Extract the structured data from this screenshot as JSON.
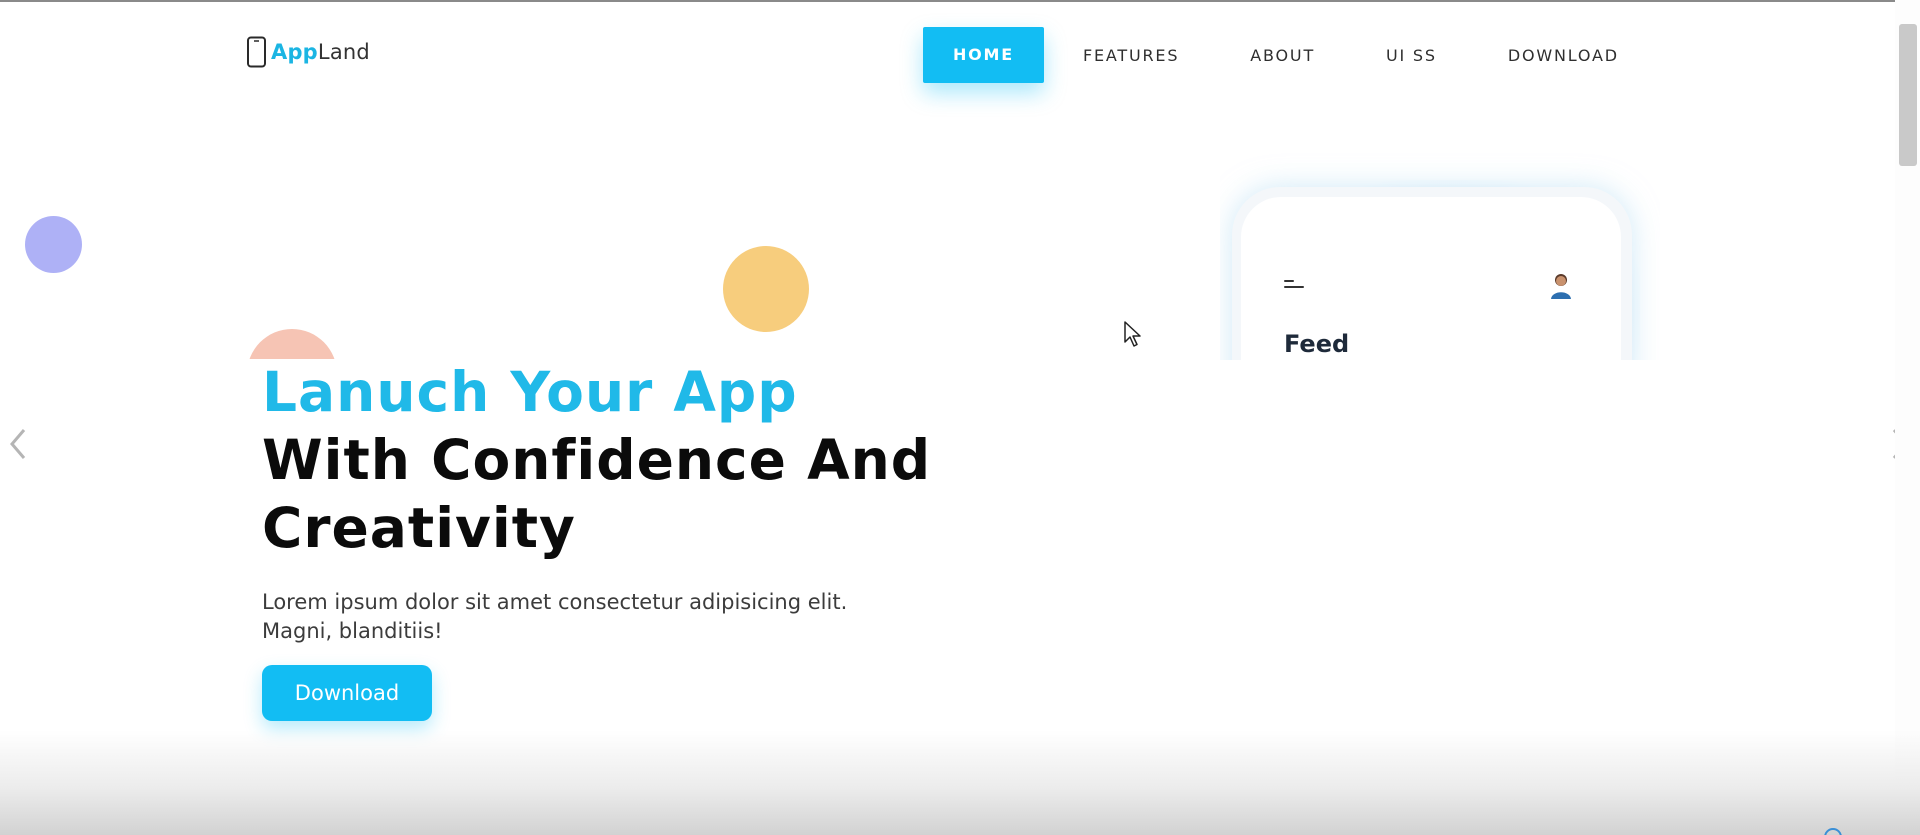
{
  "brand": {
    "name_part1": "App",
    "name_part2": "Land",
    "icon": "phone-outline-icon",
    "primary_color": "#12bdf3",
    "text_color": "#333333"
  },
  "nav": {
    "items": [
      {
        "label": "HOME",
        "active": true
      },
      {
        "label": "FEATURES",
        "active": false
      },
      {
        "label": "ABOUT",
        "active": false
      },
      {
        "label": "UI SS",
        "active": false
      },
      {
        "label": "DOWNLOAD",
        "active": false
      }
    ]
  },
  "hero": {
    "title_line1": "Lanuch Your App",
    "title_line2": "With Confidence And",
    "title_line3": "Creativity",
    "description_line1": "Lorem ipsum dolor sit amet consectetur adipisicing elit.",
    "description_line2": "Magni, blanditiis!",
    "button_label": "Download",
    "title_accent_color": "#20b9e8",
    "title_color": "#0b0b0b"
  },
  "phone": {
    "screen_title": "Feed",
    "menu_icon": "hamburger-menu-icon",
    "avatar_icon": "user-avatar-icon"
  },
  "decor": {
    "circle_colors": [
      "#aeb1f6",
      "#f7cd7d",
      "#f6c4b4"
    ]
  },
  "slider": {
    "prev_icon": "chevron-left-icon",
    "next_icon": "chevron-right-icon"
  }
}
